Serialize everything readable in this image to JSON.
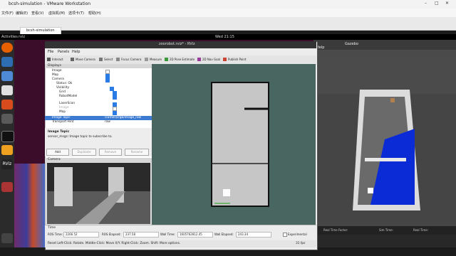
{
  "vmware": {
    "title": "bcsh-simulation - VMware Workstation",
    "menu": [
      "文件(F)",
      "编辑(E)",
      "查看(V)",
      "虚拟机(M)",
      "选项卡(T)",
      "帮助(H)"
    ],
    "tab": "bcsh-simulation"
  },
  "ubuntu": {
    "activities": "Activities",
    "app": "rviz",
    "clock": "Wed 21:15"
  },
  "rviz": {
    "title": "zoorobot.rviz* - RViz",
    "menu": [
      "File",
      "Panels",
      "Help"
    ],
    "tools": [
      "Interact",
      "Move Camera",
      "Select",
      "Focus Camera",
      "Measure",
      "2D Pose Estimate",
      "2D Nav Goal",
      "Publish Point"
    ],
    "displays": {
      "header": "Displays",
      "items": [
        {
          "label": "Image",
          "checked": false
        },
        {
          "label": "Map",
          "checked": true
        },
        {
          "label": "Camera",
          "checked": true
        },
        {
          "label": "Status: Ok",
          "checked": null
        },
        {
          "label": "Visibility",
          "checked": true
        },
        {
          "label": "Grid",
          "checked": true
        },
        {
          "label": "RobotModel",
          "checked": true
        },
        {
          "label": "LaserScan",
          "checked": true
        },
        {
          "label": "Image",
          "checked": false
        },
        {
          "label": "Map",
          "checked": true
        },
        {
          "label": "Image Topic",
          "value": "/camera/rgb/image_raw"
        },
        {
          "label": "Transport Hint",
          "value": "raw"
        }
      ],
      "help_title": "Image Topic",
      "help_text": "sensor_msgs::Image topic to subscribe to.",
      "buttons": [
        "Add",
        "Duplicate",
        "Remove",
        "Rename"
      ]
    },
    "camera_panel": "Camera",
    "time": {
      "header": "Time",
      "ros_time_label": "ROS Time:",
      "ros_time": "2266.52",
      "ros_elapsed_label": "ROS Elapsed:",
      "ros_elapsed": "237.58",
      "wall_time_label": "Wall Time:",
      "wall_time": "1605762812.45",
      "wall_elapsed_label": "Wall Elapsed:",
      "wall_elapsed": "243.34",
      "experimental": "Experimental"
    },
    "status": "Reset   Left-Click: Rotate. Middle-Click: Move X/Y. Right-Click: Zoom. Shift: More options.",
    "fps": "31 fps"
  },
  "gazebo": {
    "title": "Gazebo",
    "menu_label": "Help",
    "status": [
      "Real Time Factor:",
      "Sim Time:",
      "Real Time:"
    ]
  },
  "colors": {
    "accent": "#3d7bd2",
    "map_bg": "#4a6660",
    "gazebo_floor": "#0b2bd6"
  }
}
